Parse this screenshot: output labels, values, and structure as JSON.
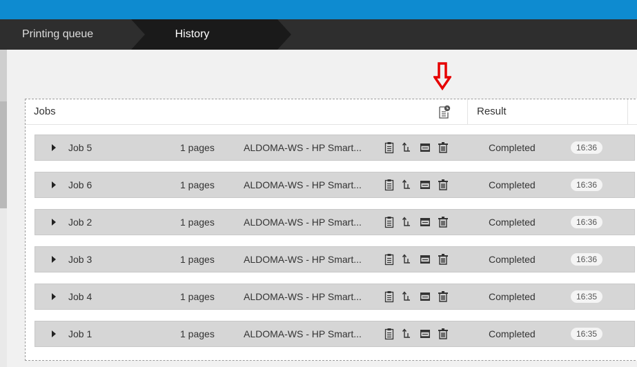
{
  "breadcrumb": {
    "items": [
      {
        "label": "Printing queue"
      },
      {
        "label": "History"
      }
    ]
  },
  "colors": {
    "accent": "#0e8bd0",
    "alert_arrow": "#e60000"
  },
  "table": {
    "headers": {
      "jobs": "Jobs",
      "result": "Result"
    },
    "rows": [
      {
        "name": "Job 5",
        "pages": "1 pages",
        "printer": "ALDOMA-WS - HP Smart...",
        "status": "Completed",
        "time": "16:36"
      },
      {
        "name": "Job 6",
        "pages": "1 pages",
        "printer": "ALDOMA-WS - HP Smart...",
        "status": "Completed",
        "time": "16:36"
      },
      {
        "name": "Job 2",
        "pages": "1 pages",
        "printer": "ALDOMA-WS - HP Smart...",
        "status": "Completed",
        "time": "16:36"
      },
      {
        "name": "Job 3",
        "pages": "1 pages",
        "printer": "ALDOMA-WS - HP Smart...",
        "status": "Completed",
        "time": "16:36"
      },
      {
        "name": "Job 4",
        "pages": "1 pages",
        "printer": "ALDOMA-WS - HP Smart...",
        "status": "Completed",
        "time": "16:35"
      },
      {
        "name": "Job 1",
        "pages": "1 pages",
        "printer": "ALDOMA-WS - HP Smart...",
        "status": "Completed",
        "time": "16:35"
      }
    ]
  },
  "icons": {
    "header": "job-info-icon",
    "row": [
      "document-icon",
      "reprint-icon",
      "printer-icon",
      "trash-icon"
    ],
    "annotation": "down-arrow-icon"
  }
}
